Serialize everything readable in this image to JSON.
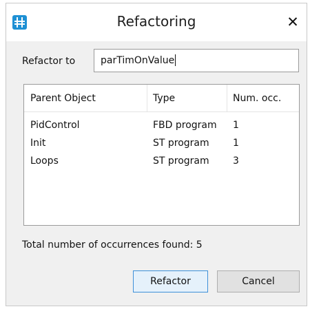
{
  "dialog": {
    "title": "Refactoring",
    "close_glyph": "✕",
    "icon": "app-grid-icon",
    "accent_color": "#1e90d4"
  },
  "form": {
    "label": "Refactor to",
    "value": "parTimOnValue"
  },
  "table": {
    "columns": [
      "Parent Object",
      "Type",
      "Num. occ."
    ],
    "rows": [
      {
        "parent": "PidControl",
        "type": "FBD program",
        "count": "1"
      },
      {
        "parent": "Init",
        "type": "ST program",
        "count": "1"
      },
      {
        "parent": "Loops",
        "type": "ST program",
        "count": "3"
      }
    ]
  },
  "summary": {
    "text": "Total number of occurrences found:  5"
  },
  "buttons": {
    "refactor": "Refactor",
    "cancel": "Cancel"
  }
}
